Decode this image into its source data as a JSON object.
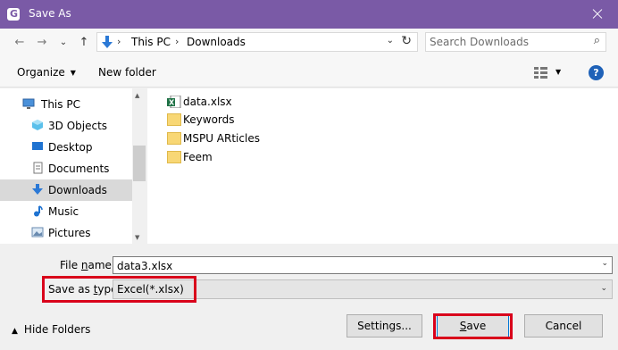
{
  "window": {
    "title": "Save As",
    "close_label": "✕"
  },
  "nav": {
    "back": "←",
    "forward": "→",
    "recent": "⌄",
    "up": "↑",
    "breadcrumbs": [
      "This PC",
      "Downloads"
    ],
    "refresh": "↻",
    "search_placeholder": "Search Downloads",
    "search_icon": "⌕"
  },
  "toolbar": {
    "organize_label": "Organize",
    "new_folder_label": "New folder",
    "help_label": "?"
  },
  "sidebar": {
    "items": [
      {
        "label": "This PC",
        "icon": "pc-icon",
        "selected": false
      },
      {
        "label": "3D Objects",
        "icon": "cube-icon",
        "selected": false
      },
      {
        "label": "Desktop",
        "icon": "desktop-icon",
        "selected": false
      },
      {
        "label": "Documents",
        "icon": "documents-icon",
        "selected": false
      },
      {
        "label": "Downloads",
        "icon": "download-icon",
        "selected": true
      },
      {
        "label": "Music",
        "icon": "music-icon",
        "selected": false
      },
      {
        "label": "Pictures",
        "icon": "pictures-icon",
        "selected": false
      }
    ]
  },
  "files": [
    {
      "name": "data.xlsx",
      "type": "excel"
    },
    {
      "name": "Keywords",
      "type": "folder"
    },
    {
      "name": "MSPU ARticles",
      "type": "folder"
    },
    {
      "name": "Feem",
      "type": "folder"
    }
  ],
  "form": {
    "file_name_label_pre": "File ",
    "file_name_label_u": "n",
    "file_name_label_post": "ame:",
    "file_name_value": "data3.xlsx",
    "save_type_label_pre": "Save as ",
    "save_type_label_u": "t",
    "save_type_label_post": "ype:",
    "save_type_value": "Excel(*.xlsx)"
  },
  "footer": {
    "hide_folders_label": "Hide Folders",
    "settings_label": "Settings...",
    "save_label_u": "S",
    "save_label_post": "ave",
    "cancel_label": "Cancel"
  },
  "colors": {
    "titlebar": "#7a5aa6",
    "highlight": "#d9001b",
    "accent": "#0078d7"
  }
}
